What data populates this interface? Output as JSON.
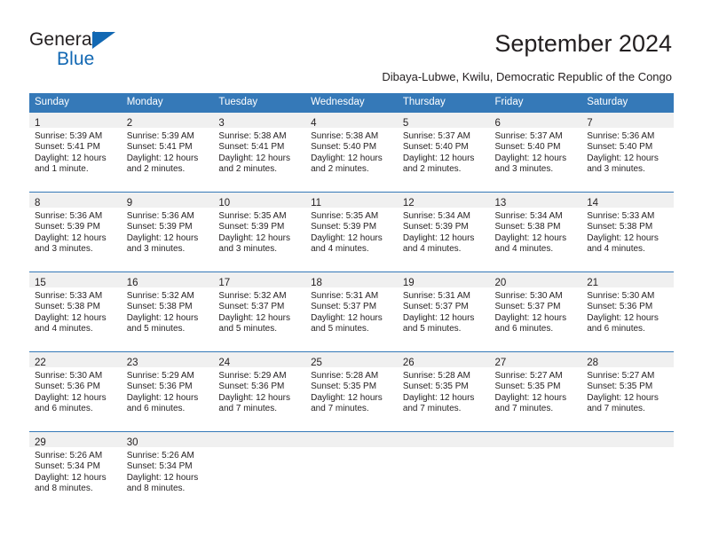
{
  "logo": {
    "word_top": "General",
    "word_bottom": "Blue",
    "accent_color": "#1268b3",
    "triangle_icon": "triangle-icon"
  },
  "header": {
    "title": "September 2024",
    "subtitle": "Dibaya-Lubwe, Kwilu, Democratic Republic of the Congo"
  },
  "theme": {
    "header_row_color": "#3579b8",
    "daynum_band_color": "#f0f0f0",
    "text_color": "#231f20"
  },
  "calendar": {
    "weekday_headers": [
      "Sunday",
      "Monday",
      "Tuesday",
      "Wednesday",
      "Thursday",
      "Friday",
      "Saturday"
    ],
    "weeks": [
      [
        {
          "day": "1",
          "sunrise": "Sunrise: 5:39 AM",
          "sunset": "Sunset: 5:41 PM",
          "daylight": "Daylight: 12 hours and 1 minute."
        },
        {
          "day": "2",
          "sunrise": "Sunrise: 5:39 AM",
          "sunset": "Sunset: 5:41 PM",
          "daylight": "Daylight: 12 hours and 2 minutes."
        },
        {
          "day": "3",
          "sunrise": "Sunrise: 5:38 AM",
          "sunset": "Sunset: 5:41 PM",
          "daylight": "Daylight: 12 hours and 2 minutes."
        },
        {
          "day": "4",
          "sunrise": "Sunrise: 5:38 AM",
          "sunset": "Sunset: 5:40 PM",
          "daylight": "Daylight: 12 hours and 2 minutes."
        },
        {
          "day": "5",
          "sunrise": "Sunrise: 5:37 AM",
          "sunset": "Sunset: 5:40 PM",
          "daylight": "Daylight: 12 hours and 2 minutes."
        },
        {
          "day": "6",
          "sunrise": "Sunrise: 5:37 AM",
          "sunset": "Sunset: 5:40 PM",
          "daylight": "Daylight: 12 hours and 3 minutes."
        },
        {
          "day": "7",
          "sunrise": "Sunrise: 5:36 AM",
          "sunset": "Sunset: 5:40 PM",
          "daylight": "Daylight: 12 hours and 3 minutes."
        }
      ],
      [
        {
          "day": "8",
          "sunrise": "Sunrise: 5:36 AM",
          "sunset": "Sunset: 5:39 PM",
          "daylight": "Daylight: 12 hours and 3 minutes."
        },
        {
          "day": "9",
          "sunrise": "Sunrise: 5:36 AM",
          "sunset": "Sunset: 5:39 PM",
          "daylight": "Daylight: 12 hours and 3 minutes."
        },
        {
          "day": "10",
          "sunrise": "Sunrise: 5:35 AM",
          "sunset": "Sunset: 5:39 PM",
          "daylight": "Daylight: 12 hours and 3 minutes."
        },
        {
          "day": "11",
          "sunrise": "Sunrise: 5:35 AM",
          "sunset": "Sunset: 5:39 PM",
          "daylight": "Daylight: 12 hours and 4 minutes."
        },
        {
          "day": "12",
          "sunrise": "Sunrise: 5:34 AM",
          "sunset": "Sunset: 5:39 PM",
          "daylight": "Daylight: 12 hours and 4 minutes."
        },
        {
          "day": "13",
          "sunrise": "Sunrise: 5:34 AM",
          "sunset": "Sunset: 5:38 PM",
          "daylight": "Daylight: 12 hours and 4 minutes."
        },
        {
          "day": "14",
          "sunrise": "Sunrise: 5:33 AM",
          "sunset": "Sunset: 5:38 PM",
          "daylight": "Daylight: 12 hours and 4 minutes."
        }
      ],
      [
        {
          "day": "15",
          "sunrise": "Sunrise: 5:33 AM",
          "sunset": "Sunset: 5:38 PM",
          "daylight": "Daylight: 12 hours and 4 minutes."
        },
        {
          "day": "16",
          "sunrise": "Sunrise: 5:32 AM",
          "sunset": "Sunset: 5:38 PM",
          "daylight": "Daylight: 12 hours and 5 minutes."
        },
        {
          "day": "17",
          "sunrise": "Sunrise: 5:32 AM",
          "sunset": "Sunset: 5:37 PM",
          "daylight": "Daylight: 12 hours and 5 minutes."
        },
        {
          "day": "18",
          "sunrise": "Sunrise: 5:31 AM",
          "sunset": "Sunset: 5:37 PM",
          "daylight": "Daylight: 12 hours and 5 minutes."
        },
        {
          "day": "19",
          "sunrise": "Sunrise: 5:31 AM",
          "sunset": "Sunset: 5:37 PM",
          "daylight": "Daylight: 12 hours and 5 minutes."
        },
        {
          "day": "20",
          "sunrise": "Sunrise: 5:30 AM",
          "sunset": "Sunset: 5:37 PM",
          "daylight": "Daylight: 12 hours and 6 minutes."
        },
        {
          "day": "21",
          "sunrise": "Sunrise: 5:30 AM",
          "sunset": "Sunset: 5:36 PM",
          "daylight": "Daylight: 12 hours and 6 minutes."
        }
      ],
      [
        {
          "day": "22",
          "sunrise": "Sunrise: 5:30 AM",
          "sunset": "Sunset: 5:36 PM",
          "daylight": "Daylight: 12 hours and 6 minutes."
        },
        {
          "day": "23",
          "sunrise": "Sunrise: 5:29 AM",
          "sunset": "Sunset: 5:36 PM",
          "daylight": "Daylight: 12 hours and 6 minutes."
        },
        {
          "day": "24",
          "sunrise": "Sunrise: 5:29 AM",
          "sunset": "Sunset: 5:36 PM",
          "daylight": "Daylight: 12 hours and 7 minutes."
        },
        {
          "day": "25",
          "sunrise": "Sunrise: 5:28 AM",
          "sunset": "Sunset: 5:35 PM",
          "daylight": "Daylight: 12 hours and 7 minutes."
        },
        {
          "day": "26",
          "sunrise": "Sunrise: 5:28 AM",
          "sunset": "Sunset: 5:35 PM",
          "daylight": "Daylight: 12 hours and 7 minutes."
        },
        {
          "day": "27",
          "sunrise": "Sunrise: 5:27 AM",
          "sunset": "Sunset: 5:35 PM",
          "daylight": "Daylight: 12 hours and 7 minutes."
        },
        {
          "day": "28",
          "sunrise": "Sunrise: 5:27 AM",
          "sunset": "Sunset: 5:35 PM",
          "daylight": "Daylight: 12 hours and 7 minutes."
        }
      ],
      [
        {
          "day": "29",
          "sunrise": "Sunrise: 5:26 AM",
          "sunset": "Sunset: 5:34 PM",
          "daylight": "Daylight: 12 hours and 8 minutes."
        },
        {
          "day": "30",
          "sunrise": "Sunrise: 5:26 AM",
          "sunset": "Sunset: 5:34 PM",
          "daylight": "Daylight: 12 hours and 8 minutes."
        },
        {
          "day": "",
          "sunrise": "",
          "sunset": "",
          "daylight": ""
        },
        {
          "day": "",
          "sunrise": "",
          "sunset": "",
          "daylight": ""
        },
        {
          "day": "",
          "sunrise": "",
          "sunset": "",
          "daylight": ""
        },
        {
          "day": "",
          "sunrise": "",
          "sunset": "",
          "daylight": ""
        },
        {
          "day": "",
          "sunrise": "",
          "sunset": "",
          "daylight": ""
        }
      ]
    ]
  }
}
